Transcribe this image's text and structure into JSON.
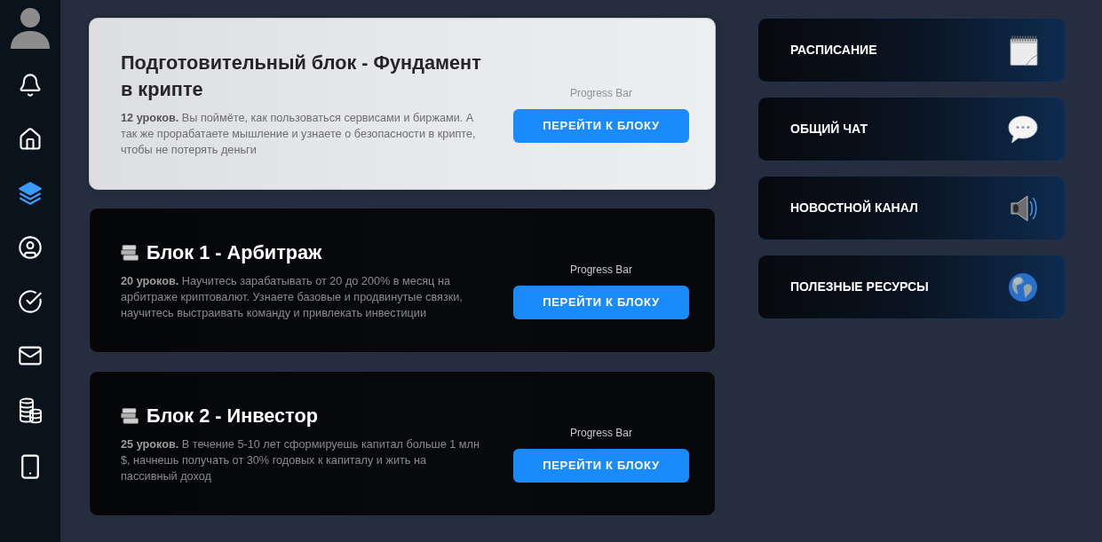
{
  "sidebar": {
    "items": [
      {
        "selected": false
      },
      {
        "selected": false
      },
      {
        "selected": true
      },
      {
        "selected": false
      },
      {
        "selected": false
      },
      {
        "selected": false
      },
      {
        "selected": false
      },
      {
        "selected": false
      }
    ]
  },
  "blocks": [
    {
      "kind": "intro",
      "title": "Подготовительный блок - Фундамент в крипте",
      "description": "**12 уроков.** Вы поймёте, как пользоваться сервисами и биржами. А так же прорабатаете мышление и узнаете о безопасности в крипте, чтобы не потерять деньги",
      "progress_label": "Progress Bar",
      "button": "ПЕРЕЙТИ К БЛОКУ"
    },
    {
      "kind": "module",
      "title": "Блок 1 - Арбитраж",
      "description": "**20 уроков.** Научитесь зарабатывать от 20 до 200% в месяц на арбитраже криптовалют. Узнаете базовые и продвинутые связки, научитесь выстраивать команду и привлекать инвестиции",
      "progress_label": "Progress Bar",
      "button": "ПЕРЕЙТИ К БЛОКУ"
    },
    {
      "kind": "module",
      "title": "Блок 2 - Инвестор",
      "description": "**25 уроков.** В течение 5-10 лет сформируешь капитал больше 1 млн $, начнешь получать от 30% годовых к капиталу и жить на пассивный доход",
      "progress_label": "Progress Bar",
      "button": "ПЕРЕЙТИ К БЛОКУ"
    }
  ],
  "links": [
    {
      "label": "РАСПИСАНИЕ"
    },
    {
      "label": "ОБЩИЙ ЧАТ"
    },
    {
      "label": "НОВОСТНОЙ КАНАЛ"
    },
    {
      "label": "ПОЛЕЗНЫЕ РЕСУРСЫ"
    }
  ]
}
